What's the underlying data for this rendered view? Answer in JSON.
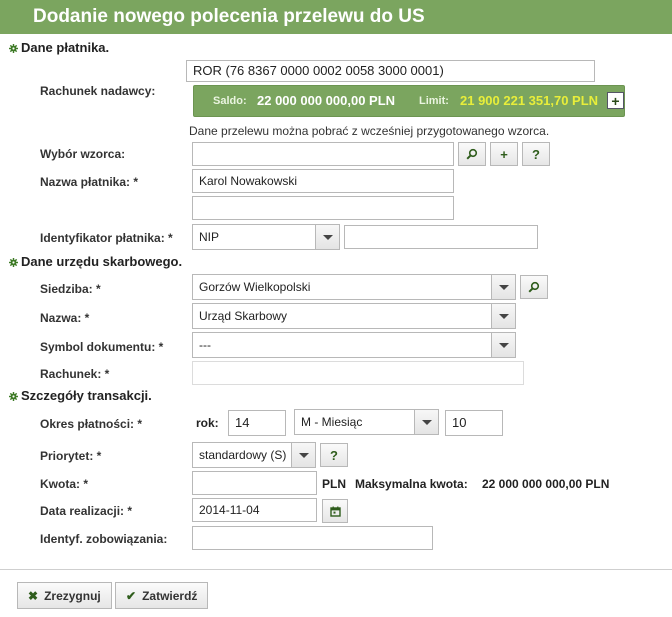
{
  "title": "Dodanie nowego polecenia przelewu do US",
  "sections": {
    "payer": "Dane płatnika.",
    "office": "Dane urzędu skarbowego.",
    "transaction": "Szczegóły transakcji."
  },
  "payer": {
    "account_label": "Rachunek nadawcy:",
    "account_value": "ROR (76 8367 0000 0002 0058 3000 0001)",
    "saldo_label": "Saldo:",
    "saldo_value": "22 000 000 000,00 PLN",
    "limit_label": "Limit:",
    "limit_value": "21 900 221 351,70 PLN",
    "template_hint": "Dane przelewu można pobrać z wcześniej przygotowanego wzorca.",
    "template_label": "Wybór wzorca:",
    "template_value": "",
    "name_label": "Nazwa płatnika: *",
    "name_value": "Karol Nowakowski",
    "name_value_2": "",
    "id_label": "Identyfikator płatnika: *",
    "id_type": "NIP",
    "id_value": ""
  },
  "office": {
    "seat_label": "Siedziba: *",
    "seat_value": "Gorzów Wielkopolski",
    "name_label": "Nazwa: *",
    "name_value": "Urząd Skarbowy",
    "symbol_label": "Symbol dokumentu: *",
    "symbol_value": "---",
    "account_label": "Rachunek: *",
    "account_value": ""
  },
  "transaction": {
    "period_label": "Okres płatności: *",
    "year_label": "rok:",
    "year_value": "14",
    "period_type": "M - Miesiąc",
    "period_value": "10",
    "priority_label": "Priorytet: *",
    "priority_value": "standardowy (S)",
    "amount_label": "Kwota: *",
    "amount_value": "",
    "currency": "PLN",
    "max_label": "Maksymalna kwota:",
    "max_value": "22 000 000 000,00 PLN",
    "date_label": "Data realizacji: *",
    "date_value": "2014-11-04",
    "obligation_label": "Identyf. zobowiązania:",
    "obligation_value": ""
  },
  "buttons": {
    "cancel": "Zrezygnuj",
    "confirm": "Zatwierdź",
    "help": "?",
    "add": "+"
  },
  "colors": {
    "accent": "#7ba55f",
    "limit": "#e8ee3a",
    "icon": "#2f5d1c"
  }
}
